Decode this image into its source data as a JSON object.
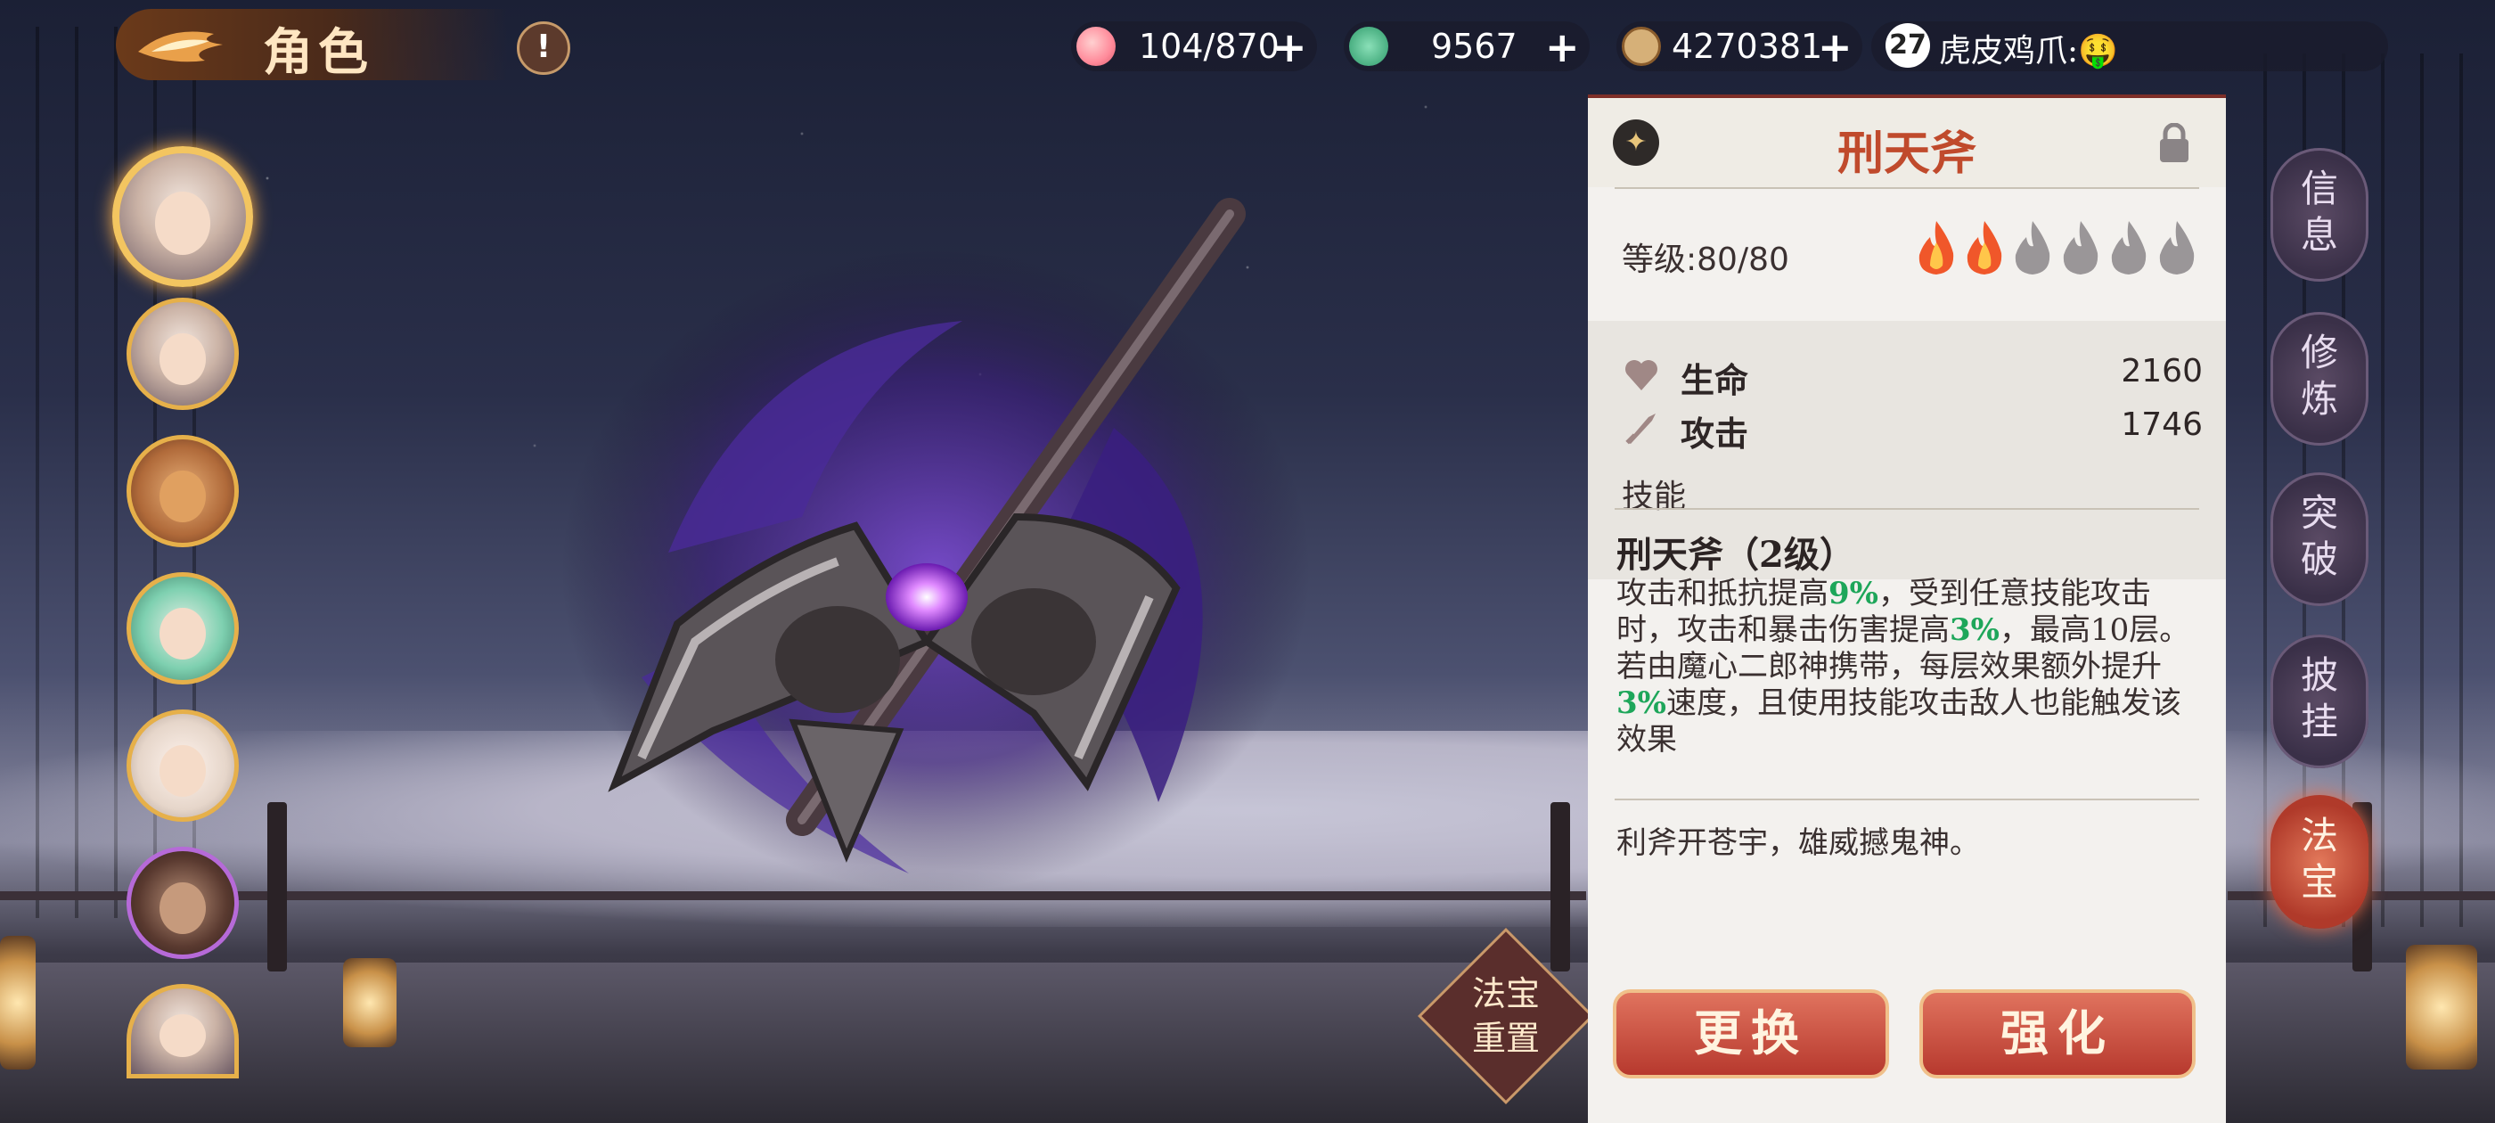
{
  "header": {
    "title": "角色",
    "alert_label": "!"
  },
  "resources": [
    {
      "icon": "peach-icon",
      "value": "104/870"
    },
    {
      "icon": "jade-icon",
      "value": "9567"
    },
    {
      "icon": "coin-icon",
      "value": "4270381"
    }
  ],
  "plus_label": "+",
  "user": {
    "level": "27",
    "name": "虎皮鸡爪:🤑"
  },
  "avatars": [
    "avatar-1",
    "avatar-2",
    "avatar-3",
    "avatar-4",
    "avatar-5",
    "avatar-6",
    "avatar-7"
  ],
  "reset_button": {
    "line1": "法宝",
    "line2": "重置"
  },
  "item": {
    "name": "刑天斧",
    "level_label": "等级:80/80",
    "stars_filled": 2,
    "stars_total": 6,
    "stats": [
      {
        "label": "生命",
        "value": "2160",
        "icon": "heart-icon"
      },
      {
        "label": "攻击",
        "value": "1746",
        "icon": "sword-icon"
      }
    ],
    "skill_heading": "技能",
    "skill_name": "刑天斧（2级）",
    "skill_desc": {
      "p1": "攻击和抵抗提高",
      "h1": "9%",
      "p2": "，受到任意技能攻击时，攻击和暴击伤害提高",
      "h2": "3%",
      "p3": "，最高10层。若由魔心二郎神携带，每层效果额外提升",
      "h3": "3%",
      "p4": "速度，且使用技能攻击敌人也能触发该效果"
    },
    "flavor": "利斧开苍宇，雄威撼鬼神。",
    "buttons": {
      "replace": "更换",
      "upgrade": "强化"
    }
  },
  "side_tabs": [
    {
      "label_a": "信",
      "label_b": "息"
    },
    {
      "label_a": "修",
      "label_b": "炼"
    },
    {
      "label_a": "突",
      "label_b": "破"
    },
    {
      "label_a": "披",
      "label_b": "挂"
    },
    {
      "label_a": "法",
      "label_b": "宝"
    }
  ],
  "colors": {
    "accent_red": "#c04a2c",
    "highlight_green": "#1ea65a",
    "avatar_border": "#e6b04a"
  }
}
